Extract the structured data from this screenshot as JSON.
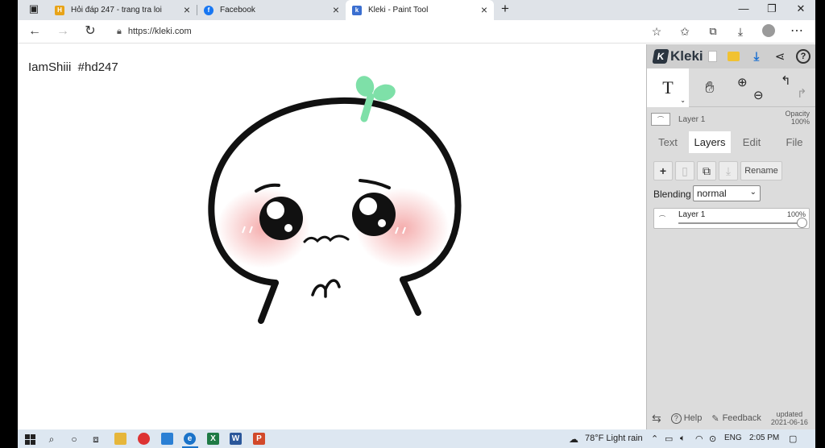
{
  "browser": {
    "tabs": [
      {
        "title": "Hỏi đáp 247 - trang tra loi",
        "favicon": "hoidap-icon",
        "color": "#e8a317"
      },
      {
        "title": "Facebook",
        "favicon": "facebook-icon",
        "color": "#1877f2"
      },
      {
        "title": "Kleki - Paint Tool",
        "favicon": "kleki-icon",
        "color": "#3b6fd0",
        "active": true
      }
    ],
    "new_tab": "+",
    "url": "https://kleki.com",
    "window_controls": {
      "minimize": "—",
      "restore": "❐",
      "close": "✕"
    }
  },
  "canvas": {
    "text": "IamShiii  #hd247",
    "drawing": "cute-blob-face-drawing",
    "colors": {
      "outline": "#111111",
      "sprout": "#7ee0a8",
      "blush": "#f6b6b6"
    }
  },
  "kleki": {
    "logo": "Kleki",
    "tools": [
      "text-tool",
      "hand-tool",
      "zoom-tool",
      "undo-redo"
    ],
    "text_tool_glyph": "T",
    "current_layer": "Layer 1",
    "opacity_label": "Opacity",
    "opacity_value": "100%",
    "tabs": [
      "Text",
      "Layers",
      "Edit",
      "File"
    ],
    "active_tab": "Layers",
    "rename": "Rename",
    "blending_label": "Blending",
    "blending_value": "normal",
    "layers": [
      {
        "name": "Layer 1",
        "opacity": "100%"
      }
    ],
    "footer": {
      "help": "Help",
      "feedback": "Feedback",
      "updated_label": "updated",
      "updated_date": "2021-06-16"
    }
  },
  "taskbar": {
    "weather": "78°F  Light rain",
    "lang": "ENG",
    "time": "2:05 PM",
    "apps": [
      {
        "name": "explorer-icon",
        "color": "#e6b63b",
        "glyph": "▬"
      },
      {
        "name": "app-spiral-icon",
        "color": "#d33",
        "glyph": "◎"
      },
      {
        "name": "computer-icon",
        "color": "#2a7fd4",
        "glyph": "▭"
      },
      {
        "name": "edge-icon",
        "color": "#1a73c9",
        "glyph": "e"
      },
      {
        "name": "excel-icon",
        "color": "#1f7a45",
        "glyph": "X"
      },
      {
        "name": "word-icon",
        "color": "#2b579a",
        "glyph": "W"
      },
      {
        "name": "powerpoint-icon",
        "color": "#d2492a",
        "glyph": "P"
      }
    ]
  }
}
